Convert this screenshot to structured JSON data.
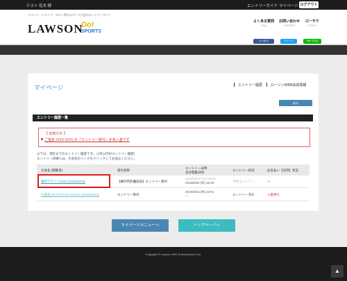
{
  "topbar": {
    "user": "テスト  花木  様",
    "entry_guide": "エントリーガイド",
    "mypage": "マイページ",
    "logout": "ログアウト"
  },
  "header": {
    "tagline": "マラソン・ドライブ・スキー等のスポーツ大会のエントリーサイト",
    "logo": "LAWSON",
    "logo_do": "Do!",
    "logo_sports": "SPORTS",
    "nav": [
      {
        "label": "よくある質問",
        "sub": "FAQ"
      },
      {
        "label": "お問い合わせ",
        "sub": "CONTACT"
      },
      {
        "label": "ローチケ",
        "sub": "TICKET"
      }
    ],
    "social": [
      {
        "label": "いいね! 0",
        "color": "#3b5998"
      },
      {
        "label": "ツイート",
        "color": "#1da1f2"
      },
      {
        "label": "LINEで送る",
        "color": "#00b900"
      }
    ]
  },
  "card": {
    "title": "マイページ",
    "nav": [
      "エントリー履歴",
      "ローソンWEB会員情報"
    ],
    "back_button": "戻る",
    "section_title": "エントリー履歴一覧",
    "notice": {
      "title": "【 お知らせ 】",
      "link": "ご指定 (XXX-XXX) の「エントリー受付」が未入金です"
    },
    "intro": [
      "以下は、現在までのエントリー履歴です。 (1年以内のエントリー履歴)",
      "エントリー詳細へは、大会名のリンクをクリックしてお進みください。"
    ],
    "table": {
      "headers": {
        "event": "大会名 (開催日)",
        "reception": "受付名称",
        "entry_date_1": "エントリー日時",
        "entry_date_2": "合計閲覧日時",
        "status": "エントリー状況",
        "payment": "お支払い【決済】状況"
      },
      "rows": [
        {
          "event": "横浜マラソン2018 (2018/10/28)",
          "reception": "【横浜市民優先枠】エントリー受付",
          "date_1": "2018/05/15 (火) 00:00",
          "date_2": "2018/5/30 (木) 15:00",
          "status": "予約エントリー",
          "payment": "ー"
        },
        {
          "event": "九重連 MARATHON KOKUE (2018/05/13)",
          "reception": "エントリー受付",
          "date_1": "2018/3/15 (木) 22:01",
          "date_2": "ー",
          "status": "エントリー済み",
          "payment": "入金待ち"
        }
      ]
    }
  },
  "buttons": {
    "mypage_menu": "マイページメニューへ",
    "to_top": "トップページへ"
  },
  "footer": {
    "copyright": "Copyright © Lawson HMV Entertainment, Inc."
  },
  "colors": {
    "accent": "#2fa3b8",
    "menu_button": "#4a86b4",
    "top_button": "#3bbcc0",
    "alert": "#d03030"
  }
}
